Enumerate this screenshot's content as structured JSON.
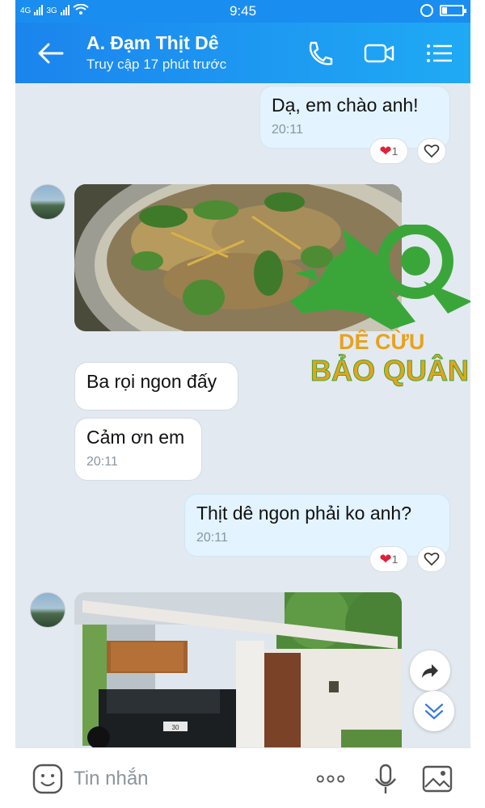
{
  "status_bar": {
    "time": "9:45",
    "net1": "4G",
    "net2": "3G"
  },
  "header": {
    "contact_name": "A.  Đạm Thịt Dê",
    "last_seen": "Truy cập 17 phút trước"
  },
  "messages": [
    {
      "type": "text",
      "direction": "outgoing",
      "text": "Dạ,  em chào anh!",
      "time": "20:11",
      "reaction_count": "1"
    },
    {
      "type": "image",
      "direction": "incoming",
      "image_description": "goat meat dish"
    },
    {
      "type": "text",
      "direction": "incoming",
      "text": "Ba rọi ngon đấy"
    },
    {
      "type": "text",
      "direction": "incoming",
      "text": "Cảm ơn em",
      "time": "20:11"
    },
    {
      "type": "text",
      "direction": "outgoing",
      "text": "Thịt dê ngon phải ko anh?",
      "time": "20:11",
      "reaction_count": "1"
    },
    {
      "type": "image",
      "direction": "incoming",
      "image_description": "house with car"
    }
  ],
  "watermark": {
    "line1": "DÊ CỪU",
    "line2": "BẢO QUÂN"
  },
  "license_plate": "30",
  "input": {
    "placeholder": "Tin nhắn"
  },
  "colors": {
    "header": "#1b8af0",
    "chat_bg": "#e3e9f0",
    "outgoing_bubble": "#e3f3ff",
    "incoming_bubble": "#ffffff",
    "watermark_green": "#3aa63a"
  }
}
